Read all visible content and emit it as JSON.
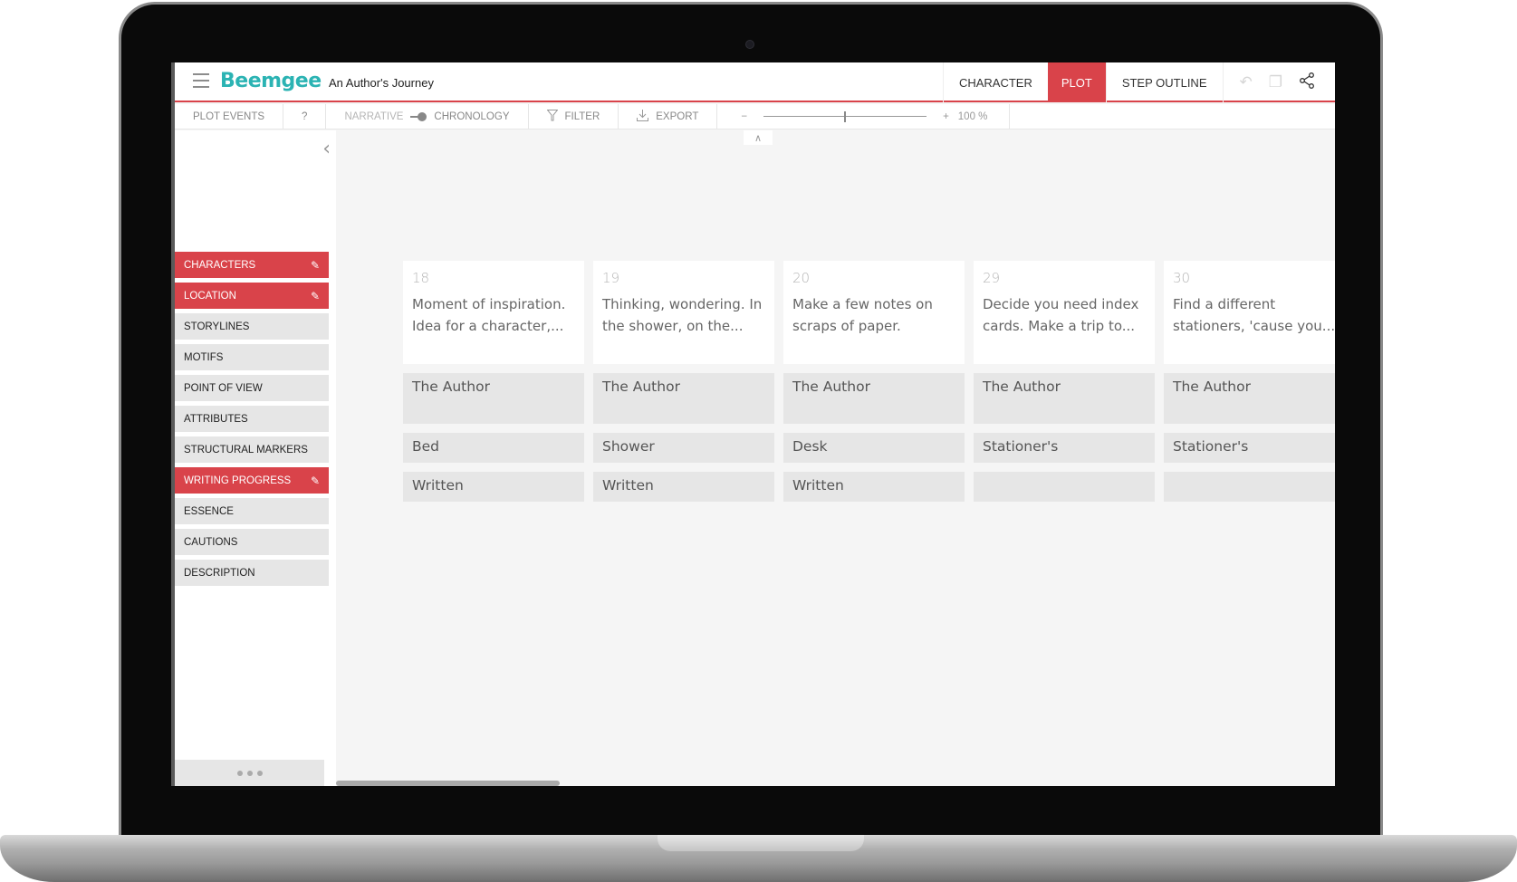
{
  "app": {
    "logo": "Beemgee",
    "document_title": "An Author's Journey"
  },
  "nav": {
    "tabs": [
      {
        "label": "CHARACTER",
        "active": false
      },
      {
        "label": "PLOT",
        "active": true
      },
      {
        "label": "STEP OUTLINE",
        "active": false
      }
    ],
    "icons": [
      "undo-icon",
      "copy-icon",
      "share-icon"
    ]
  },
  "toolbar": {
    "plot_events": "PLOT EVENTS",
    "help": "?",
    "narrative": "NARRATIVE",
    "chronology": "CHRONOLOGY",
    "filter": "FILTER",
    "export": "EXPORT",
    "zoom_minus": "−",
    "zoom_plus": "+",
    "zoom_level": "100 %",
    "zoom_value_fraction": 0.5
  },
  "sidebar": {
    "items": [
      {
        "label": "CHARACTERS",
        "active": true
      },
      {
        "label": "LOCATION",
        "active": true
      },
      {
        "label": "STORYLINES",
        "active": false
      },
      {
        "label": "MOTIFS",
        "active": false
      },
      {
        "label": "POINT OF VIEW",
        "active": false
      },
      {
        "label": "ATTRIBUTES",
        "active": false
      },
      {
        "label": "STRUCTURAL MARKERS",
        "active": false
      },
      {
        "label": "WRITING PROGRESS",
        "active": true
      },
      {
        "label": "ESSENCE",
        "active": false
      },
      {
        "label": "CAUTIONS",
        "active": false
      },
      {
        "label": "DESCRIPTION",
        "active": false
      }
    ]
  },
  "events": [
    {
      "number": "18",
      "description_line1": "Moment of inspiration.",
      "description_line2": "Idea for a character,...",
      "character": "The Author",
      "location": "Bed",
      "progress": "Written"
    },
    {
      "number": "19",
      "description_line1": "Thinking, wondering. In",
      "description_line2": "the shower, on the...",
      "character": "The Author",
      "location": "Shower",
      "progress": "Written"
    },
    {
      "number": "20",
      "description_line1": "Make a few notes on",
      "description_line2": "scraps of paper.",
      "character": "The Author",
      "location": "Desk",
      "progress": "Written"
    },
    {
      "number": "29",
      "description_line1": "Decide you need index",
      "description_line2": "cards. Make a trip to...",
      "character": "The Author",
      "location": "Stationer's",
      "progress": ""
    },
    {
      "number": "30",
      "description_line1": "Find a different",
      "description_line2": "stationers, 'cause you...",
      "character": "The Author",
      "location": "Stationer's",
      "progress": ""
    }
  ],
  "colors": {
    "accent": "#d9434a",
    "logo": "#2bb3b3",
    "cell_bg": "#e6e6e6",
    "canvas_bg": "#f5f5f5"
  }
}
